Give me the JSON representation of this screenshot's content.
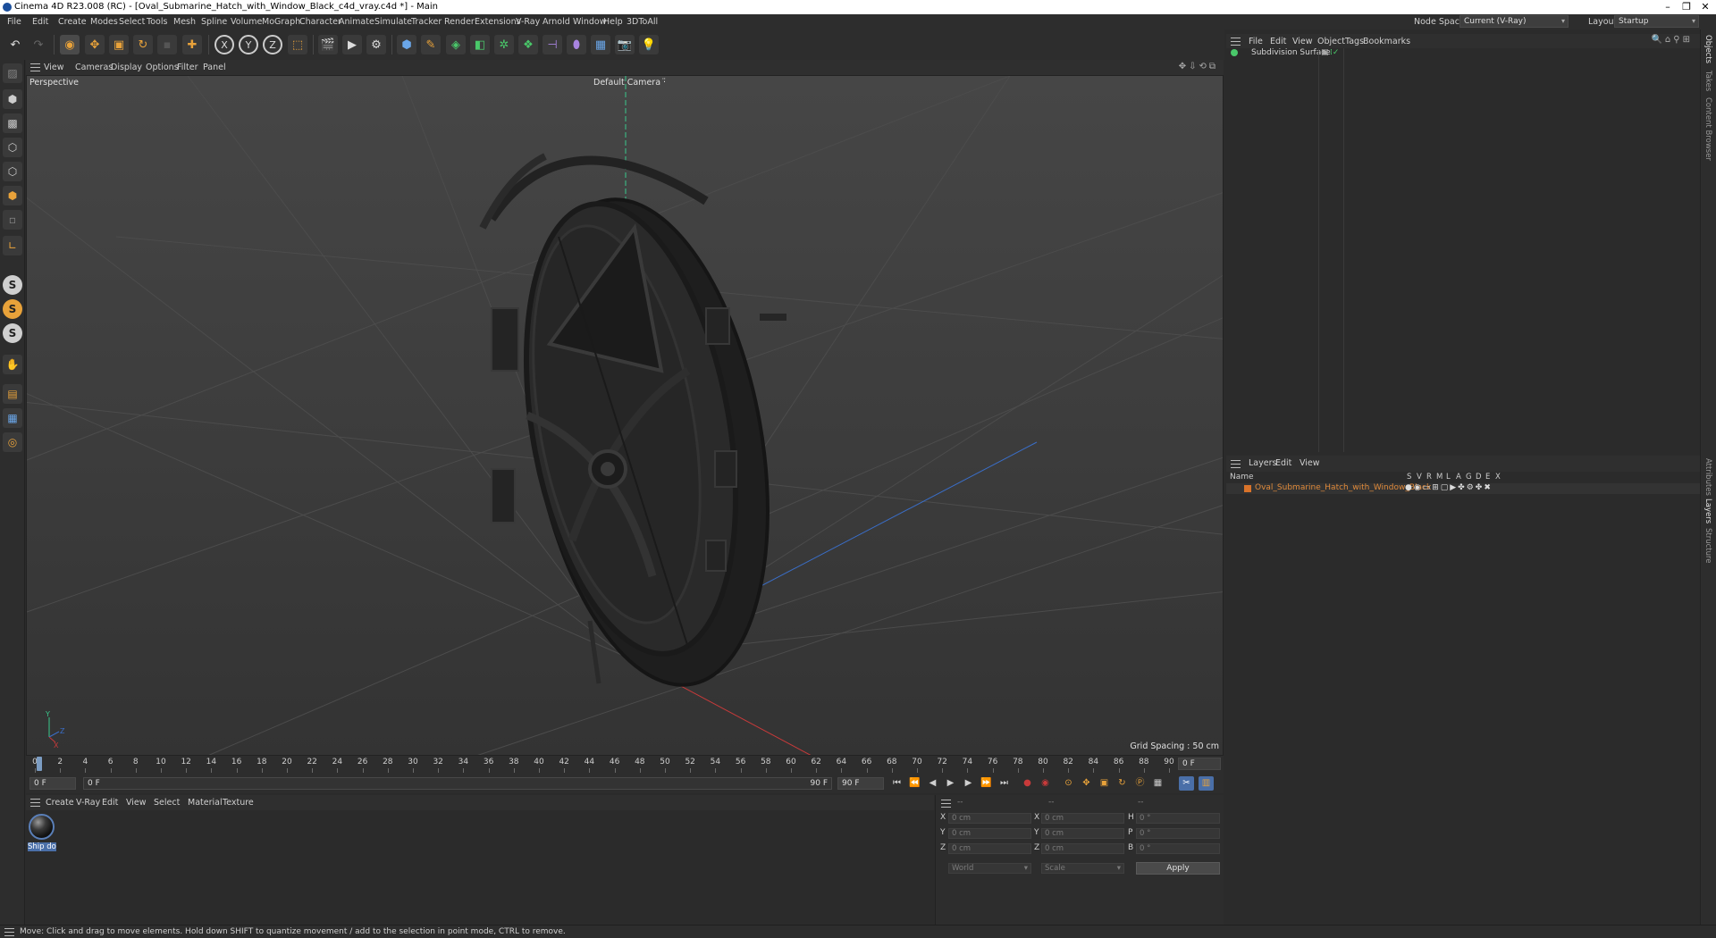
{
  "window": {
    "title": "Cinema 4D R23.008 (RC) - [Oval_Submarine_Hatch_with_Window_Black_c4d_vray.c4d *] - Main"
  },
  "menubar": {
    "items": [
      "File",
      "Edit",
      "Create",
      "Modes",
      "Select",
      "Tools",
      "Mesh",
      "Spline",
      "Volume",
      "MoGraph",
      "Character",
      "Animate",
      "Simulate",
      "Tracker",
      "Render",
      "Extensions",
      "V-Ray",
      "Arnold",
      "Window",
      "Help",
      "3DToAll"
    ],
    "node_space_label": "Node Space:",
    "node_space_value": "Current (V-Ray)",
    "layout_label": "Layout:",
    "layout_value": "Startup"
  },
  "viewport": {
    "menu": [
      "View",
      "Cameras",
      "Display",
      "Options",
      "Filter",
      "Panel"
    ],
    "projection": "Perspective",
    "camera": "Default Camera",
    "grid_spacing": "Grid Spacing : 50 cm",
    "axis_labels": {
      "y": "Y",
      "z": "Z",
      "x": "X"
    }
  },
  "timeline": {
    "ticks": [
      "0",
      "2",
      "4",
      "6",
      "8",
      "10",
      "12",
      "14",
      "16",
      "18",
      "20",
      "22",
      "24",
      "26",
      "28",
      "30",
      "32",
      "34",
      "36",
      "38",
      "40",
      "42",
      "44",
      "46",
      "48",
      "50",
      "52",
      "54",
      "56",
      "58",
      "60",
      "62",
      "64",
      "66",
      "68",
      "70",
      "72",
      "74",
      "76",
      "78",
      "80",
      "82",
      "84",
      "86",
      "88",
      "90"
    ],
    "current_frame_field": "0 F",
    "start_field": "0 F",
    "range_start": "0 F",
    "range_end": "90 F",
    "end_field": "90 F"
  },
  "material_manager": {
    "menu": [
      "Create",
      "V-Ray",
      "Edit",
      "View",
      "Select",
      "Material",
      "Texture"
    ],
    "materials": [
      {
        "name": "Ship doo"
      }
    ]
  },
  "coordinates": {
    "headers": [
      "--",
      "--",
      "--"
    ],
    "rows": [
      {
        "pos_label": "X",
        "pos": "0 cm",
        "size_label": "X",
        "size": "0 cm",
        "rot_label": "H",
        "rot": "0 °"
      },
      {
        "pos_label": "Y",
        "pos": "0 cm",
        "size_label": "Y",
        "size": "0 cm",
        "rot_label": "P",
        "rot": "0 °"
      },
      {
        "pos_label": "Z",
        "pos": "0 cm",
        "size_label": "Z",
        "size": "0 cm",
        "rot_label": "B",
        "rot": "0 °"
      }
    ],
    "mode_world": "World",
    "mode_scale": "Scale",
    "apply": "Apply"
  },
  "object_manager": {
    "menu": [
      "File",
      "Edit",
      "View",
      "Object",
      "Tags",
      "Bookmarks"
    ],
    "objects": [
      {
        "name": "Subdivision Surface"
      }
    ]
  },
  "layer_manager": {
    "menu": [
      "Layers",
      "Edit",
      "View"
    ],
    "column_name": "Name",
    "columns": [
      "S",
      "V",
      "R",
      "M",
      "L",
      "A",
      "G",
      "D",
      "E",
      "X"
    ],
    "layers": [
      {
        "name": "Oval_Submarine_Hatch_with_Window_Black",
        "color": "#d9732a"
      }
    ]
  },
  "side_tabs": [
    "Objects",
    "Takes",
    "Content Browser",
    "Attributes",
    "Layers",
    "Structure"
  ],
  "status": {
    "text": "Move: Click and drag to move elements. Hold down SHIFT to quantize movement / add to the selection in point mode, CTRL to remove."
  },
  "colors": {
    "accent_blue": "#5a7fb8",
    "layer_orange": "#d9732a",
    "axis_x": "#c83a3a",
    "axis_y": "#3ac88c",
    "axis_z": "#3a6ec8"
  }
}
